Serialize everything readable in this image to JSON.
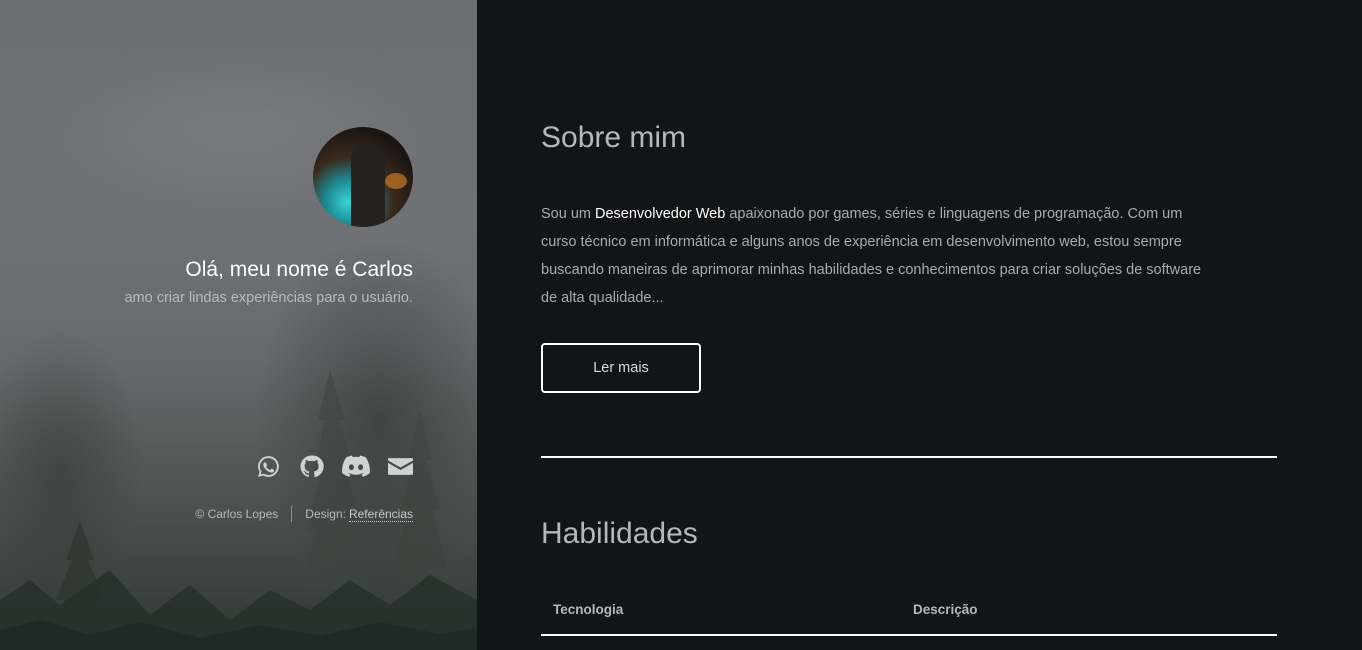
{
  "profile": {
    "greeting": "Olá, meu nome é Carlos",
    "tagline": "amo criar lindas experiências para o usuário."
  },
  "socials": [
    {
      "icon": "whatsapp-icon"
    },
    {
      "icon": "github-icon"
    },
    {
      "icon": "discord-icon"
    },
    {
      "icon": "email-icon"
    }
  ],
  "footer": {
    "copyright": "© Carlos Lopes",
    "design_prefix": "Design:",
    "design_link": "Referências"
  },
  "about": {
    "title": "Sobre mim",
    "text_before": "Sou um ",
    "highlight": "Desenvolvedor Web",
    "text_after": " apaixonado por games, séries e linguagens de programação. Com um curso técnico em informática e alguns anos de experiência em desenvolvimento web, estou sempre buscando maneiras de aprimorar minhas habilidades e conhecimentos para criar soluções de software de alta qualidade...",
    "button_label": "Ler mais"
  },
  "skills": {
    "title": "Habilidades",
    "columns": [
      "Tecnologia",
      "Descrição"
    ]
  },
  "colors": {
    "background": "#131416",
    "accent": "#ffffff"
  }
}
